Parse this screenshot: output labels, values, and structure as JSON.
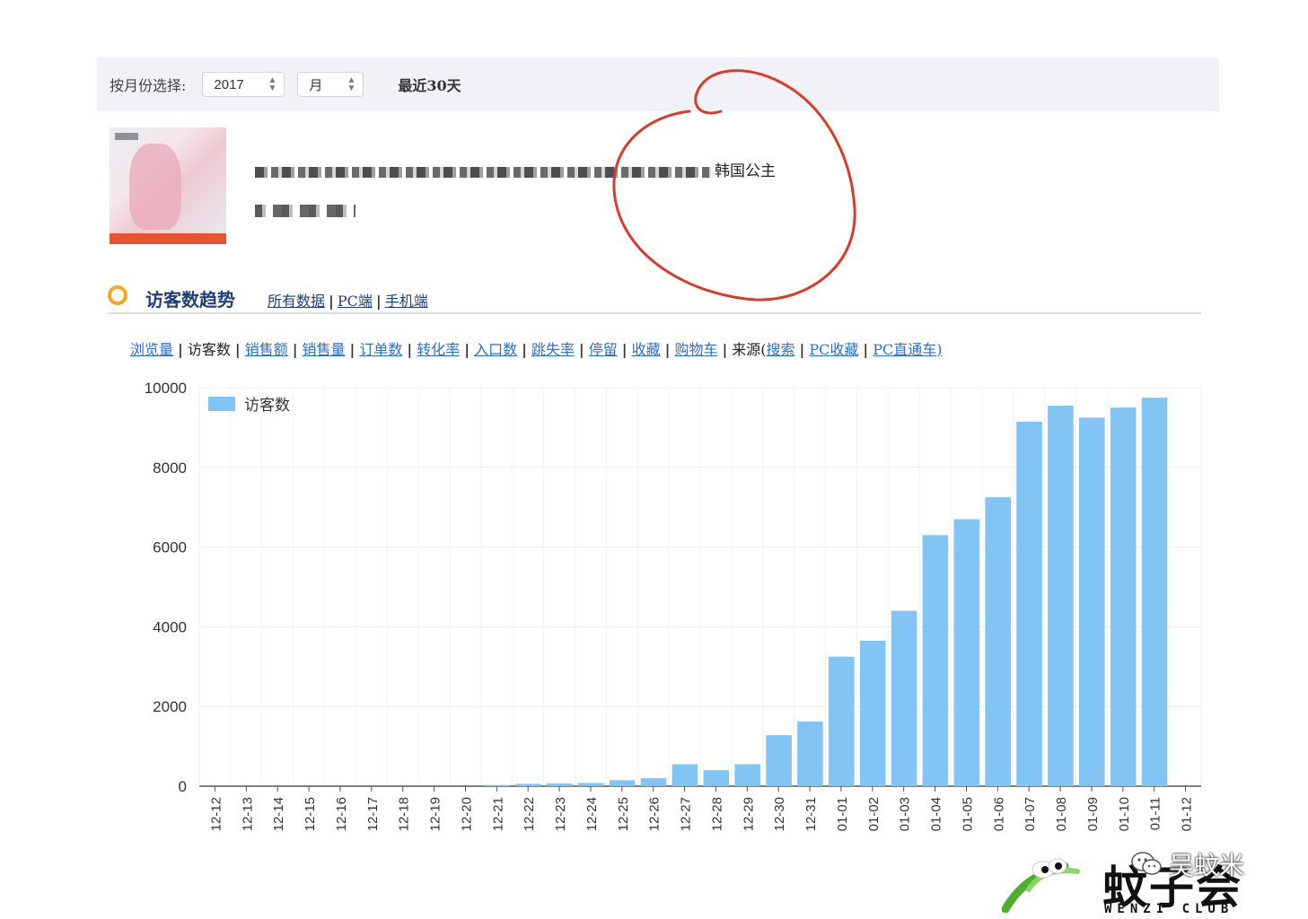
{
  "toolbar": {
    "month_label": "按月份选择:",
    "year_value": "2017",
    "month_value": "月",
    "last30": "最近30天"
  },
  "product": {
    "title_suffix": "韩国公主"
  },
  "section": {
    "title": "访客数趋势",
    "tabs": [
      "所有数据",
      "PC端",
      "手机端"
    ]
  },
  "metrics": {
    "items": [
      {
        "label": "浏览量",
        "link": true
      },
      {
        "label": "访客数",
        "link": false
      },
      {
        "label": "销售额",
        "link": true
      },
      {
        "label": "销售量",
        "link": true
      },
      {
        "label": "订单数",
        "link": true
      },
      {
        "label": "转化率",
        "link": true
      },
      {
        "label": "入口数",
        "link": true
      },
      {
        "label": "跳失率",
        "link": true
      },
      {
        "label": "停留",
        "link": true
      },
      {
        "label": "收藏",
        "link": true
      },
      {
        "label": "购物车",
        "link": true
      }
    ],
    "source_prefix": "来源(",
    "source_items": [
      "搜索",
      "PC收藏",
      "PC直通车"
    ],
    "source_suffix": ")"
  },
  "chart_data": {
    "type": "bar",
    "title": "",
    "xlabel": "",
    "ylabel": "",
    "ylim": [
      0,
      10000
    ],
    "yticks": [
      0,
      2000,
      4000,
      6000,
      8000,
      10000
    ],
    "grid": true,
    "legend": "top-left",
    "color": "#82c4f4",
    "categories": [
      "12-12",
      "12-13",
      "12-14",
      "12-15",
      "12-16",
      "12-17",
      "12-18",
      "12-19",
      "12-20",
      "12-21",
      "12-22",
      "12-23",
      "12-24",
      "12-25",
      "12-26",
      "12-27",
      "12-28",
      "12-29",
      "12-30",
      "12-31",
      "01-01",
      "01-02",
      "01-03",
      "01-04",
      "01-05",
      "01-06",
      "01-07",
      "01-08",
      "01-09",
      "01-10",
      "01-11",
      "01-12"
    ],
    "series": [
      {
        "name": "访客数",
        "values": [
          0,
          0,
          0,
          0,
          0,
          0,
          0,
          0,
          0,
          30,
          60,
          70,
          80,
          150,
          200,
          550,
          400,
          550,
          1280,
          1620,
          3250,
          3650,
          4400,
          6300,
          6700,
          7250,
          9150,
          9550,
          9250,
          9500,
          9750,
          0
        ]
      }
    ]
  },
  "watermark": {
    "logo": "蚊子会",
    "sub": "WENZI CLUB",
    "account": "吴蚊米"
  },
  "colors": {
    "annotation": "#d93a2b",
    "link": "#2a6fd6",
    "accent": "#f5a623",
    "bar": "#82c4f4"
  }
}
